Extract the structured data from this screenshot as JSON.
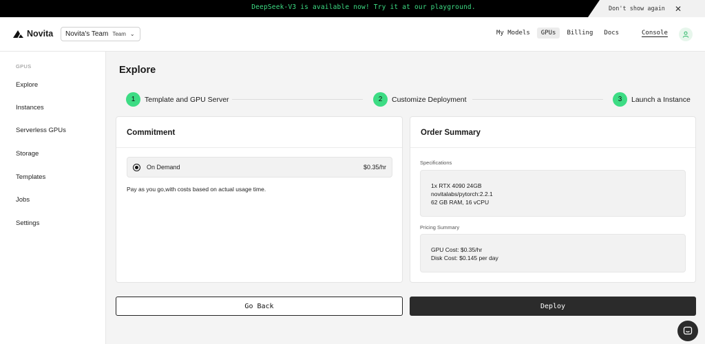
{
  "banner": {
    "message": "DeepSeek-V3 is available now! Try it at our playground.",
    "dismiss_label": "Don't show again",
    "close_icon": "✕"
  },
  "header": {
    "brand": "Novita",
    "team_name": "Novita's Team",
    "team_badge": "Team",
    "nav": [
      "My Models",
      "GPUs",
      "Billing",
      "Docs"
    ],
    "active_nav": "GPUs",
    "console_label": "Console",
    "accent_color": "#3ddc84"
  },
  "sidebar": {
    "section": "GPUS",
    "items": [
      "Explore",
      "Instances",
      "Serverless GPUs",
      "Storage",
      "Templates",
      "Jobs",
      "Settings"
    ]
  },
  "main": {
    "title": "Explore",
    "steps": [
      {
        "num": "1",
        "label": "Template and GPU Server"
      },
      {
        "num": "2",
        "label": "Customize Deployment"
      },
      {
        "num": "3",
        "label": "Launch a Instance"
      }
    ],
    "commitment": {
      "title": "Commitment",
      "option_label": "On Demand",
      "option_price": "$0.35/hr",
      "selected": true,
      "description": "Pay as you go,with costs based on actual usage time."
    },
    "summary": {
      "title": "Order Summary",
      "specs_label": "Specifications",
      "specs": [
        "1x RTX 4090 24GB",
        "novitalabs/pytorch:2.2.1",
        "62 GB RAM, 16 vCPU"
      ],
      "pricing_label": "Pricing Summary",
      "pricing": [
        "GPU Cost: $0.35/hr",
        "Disk Cost: $0.145 per day"
      ]
    },
    "back_label": "Go Back",
    "deploy_label": "Deploy"
  }
}
